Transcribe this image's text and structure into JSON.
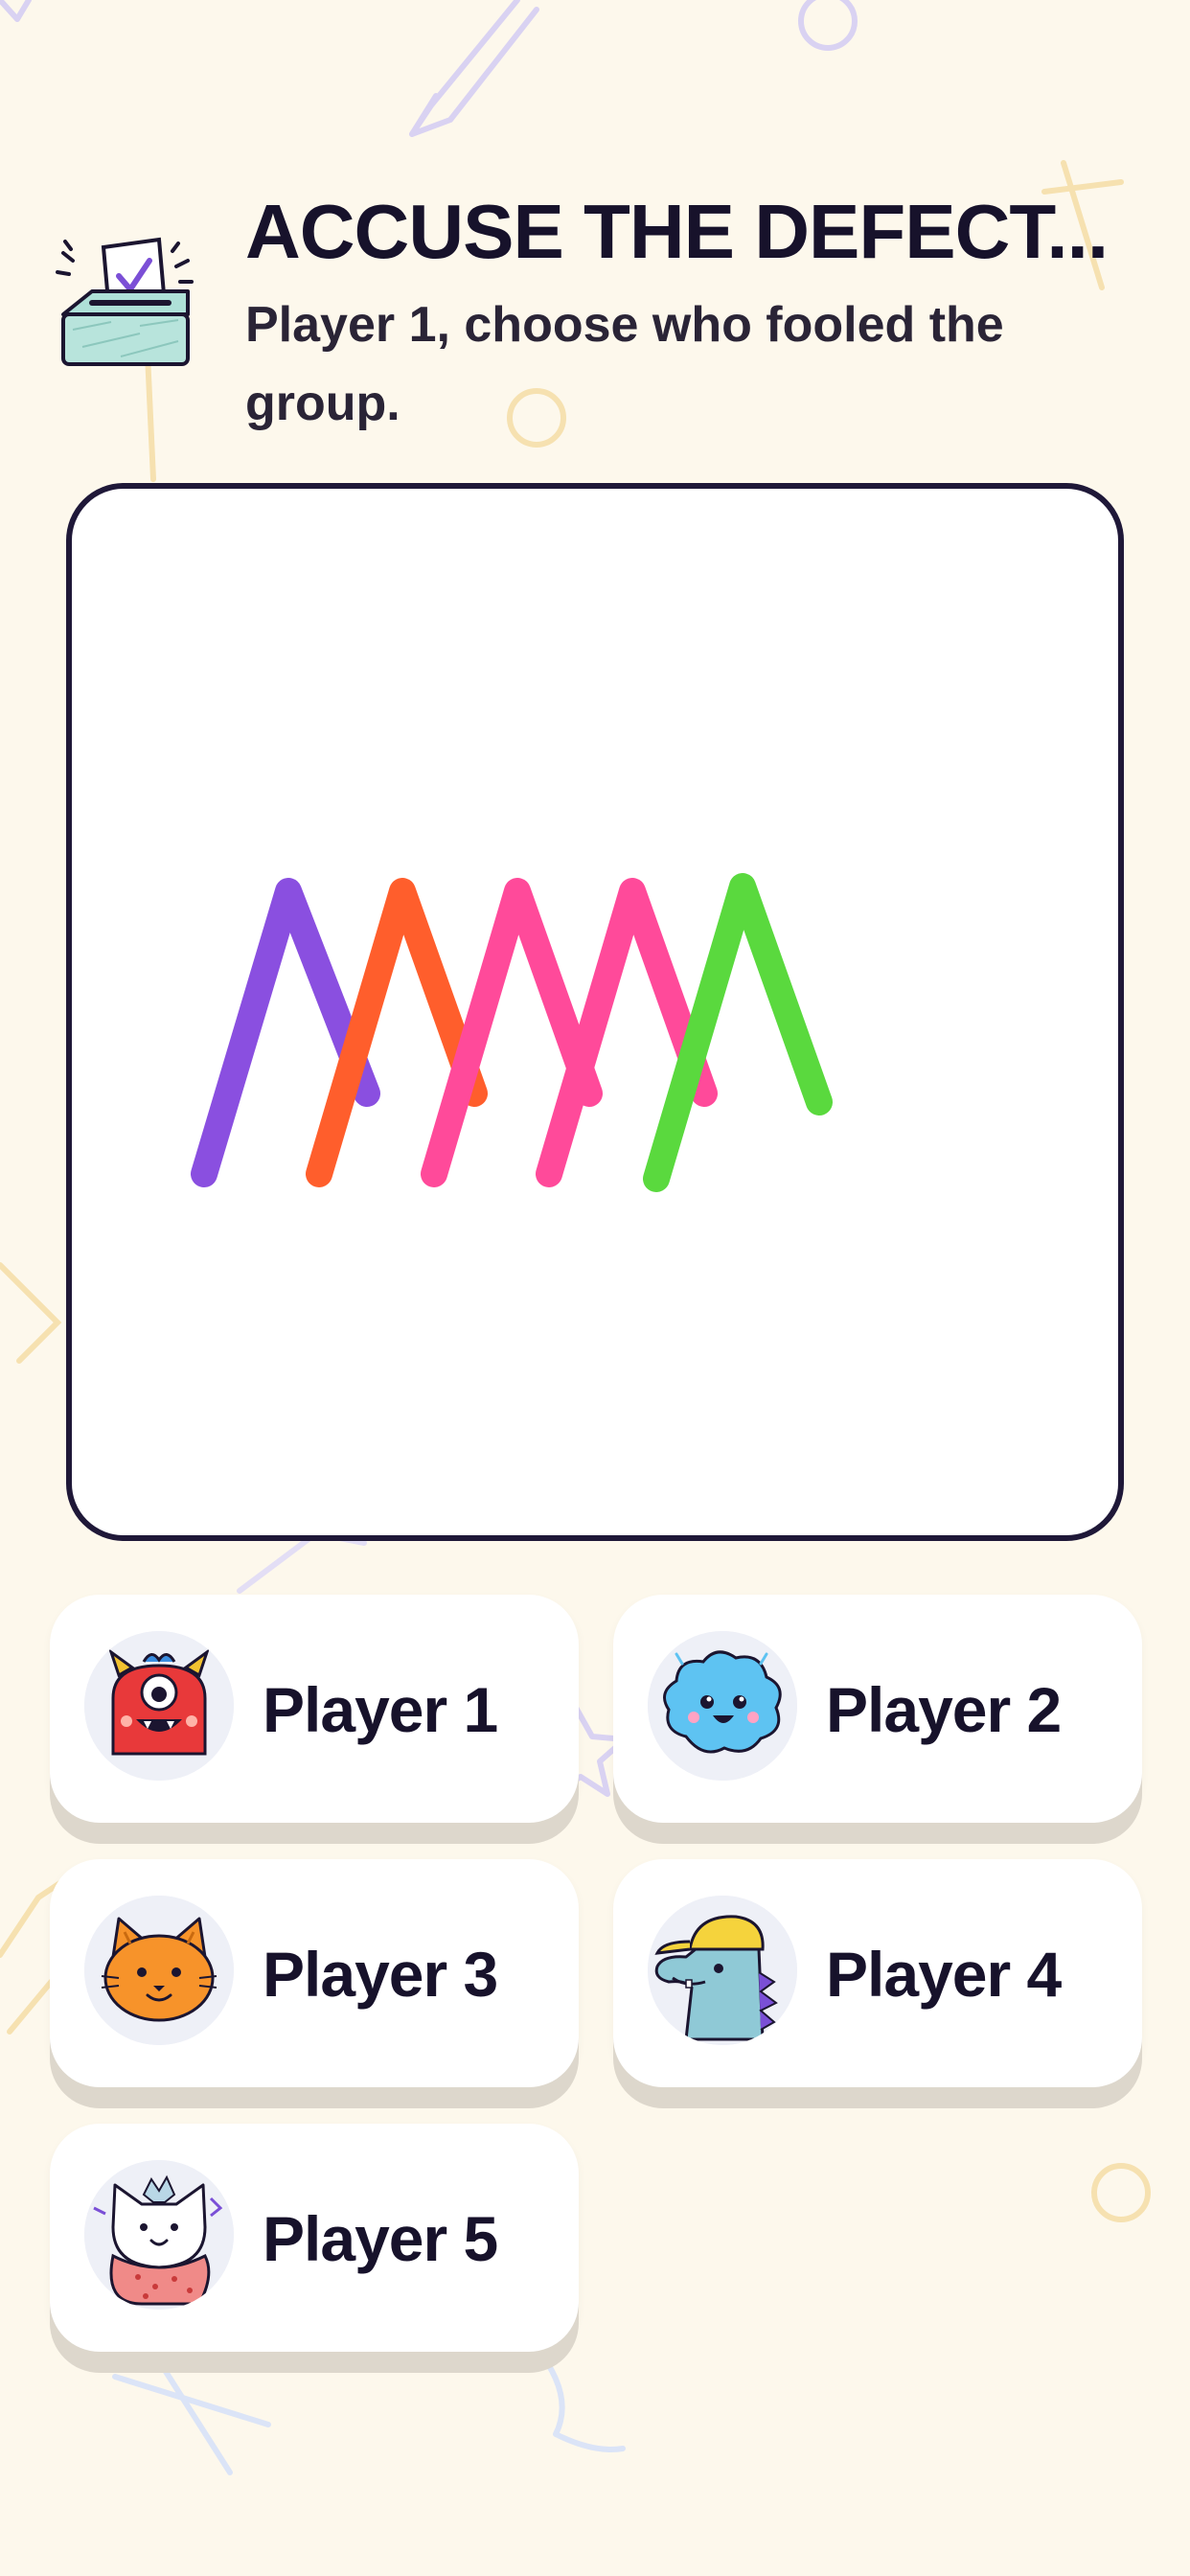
{
  "screen": {
    "title": "ACCUSE THE DEFECT...",
    "subtitle": "Player 1, choose who fooled the group."
  },
  "header_icon": "ballot-box-icon",
  "colors": {
    "background": "#fdf8ec",
    "text": "#17122b",
    "card_border": "#1f1838",
    "stroke_purple": "#8a4fe0",
    "stroke_orange": "#ff5e2c",
    "stroke_pink": "#ff4a9a",
    "stroke_green": "#5ad93e"
  },
  "drawing": {
    "strokes": [
      {
        "name": "purple-stroke",
        "color": "#8a4fe0"
      },
      {
        "name": "orange-stroke",
        "color": "#ff5e2c"
      },
      {
        "name": "pink-stroke-1",
        "color": "#ff4a9a"
      },
      {
        "name": "pink-stroke-2",
        "color": "#ff4a9a"
      },
      {
        "name": "green-stroke",
        "color": "#5ad93e"
      }
    ]
  },
  "players": [
    {
      "label": "Player 1",
      "avatar": "red-monster-avatar"
    },
    {
      "label": "Player 2",
      "avatar": "blue-cloud-avatar"
    },
    {
      "label": "Player 3",
      "avatar": "orange-cat-avatar"
    },
    {
      "label": "Player 4",
      "avatar": "dino-cap-avatar"
    },
    {
      "label": "Player 5",
      "avatar": "strawberry-cat-avatar"
    }
  ]
}
